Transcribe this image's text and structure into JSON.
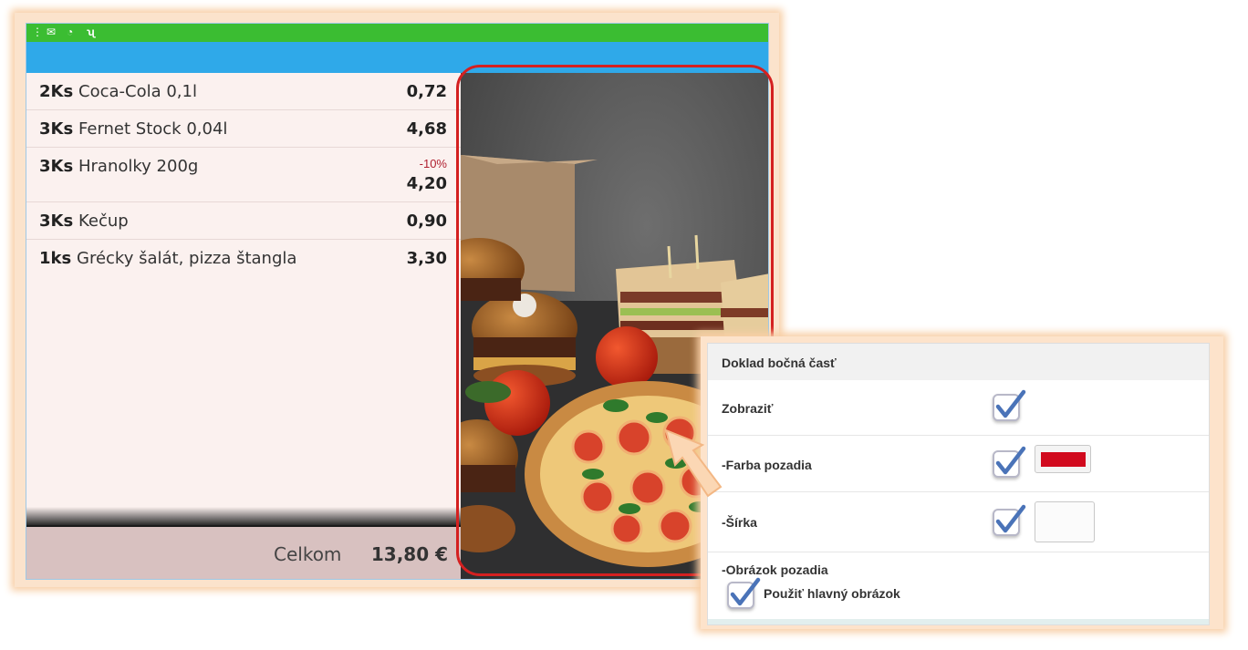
{
  "statusbar": {
    "icons": [
      "more-vert-icon",
      "mail-icon",
      "timer-icon",
      "plug-icon"
    ],
    "glyphs": [
      "⋮",
      "✉",
      "◔",
      "ʯ"
    ]
  },
  "colors": {
    "status_green": "#3bbd32",
    "title_blue": "#2fa9e9",
    "highlight_red": "#d42020",
    "swatch_red": "#d10a1e"
  },
  "receipt": {
    "items": [
      {
        "qty": "2Ks",
        "name": "Coca-Cola 0,1l",
        "price": "0,72"
      },
      {
        "qty": "3Ks",
        "name": "Fernet Stock 0,04l",
        "price": "4,68"
      },
      {
        "qty": "3Ks",
        "name": "Hranolky 200g",
        "price": "4,20",
        "discount": "-10%"
      },
      {
        "qty": "3Ks",
        "name": "Kečup",
        "price": "0,90"
      },
      {
        "qty": "1ks",
        "name": "Grécky šalát, pizza štangla",
        "price": "3,30"
      }
    ],
    "total_label": "Celkom",
    "total_value": "13,80 €"
  },
  "settings": {
    "header": "Doklad bočná časť",
    "show_label": "Zobraziť",
    "show_checked": true,
    "bg_color_label": "-Farba pozadia",
    "bg_color_checked": true,
    "width_label": "-Šírka",
    "width_checked": true,
    "width_value": "",
    "bg_image_label": "-Obrázok pozadia",
    "use_main_image_label": "Použiť hlavný obrázok",
    "use_main_image_checked": true
  }
}
